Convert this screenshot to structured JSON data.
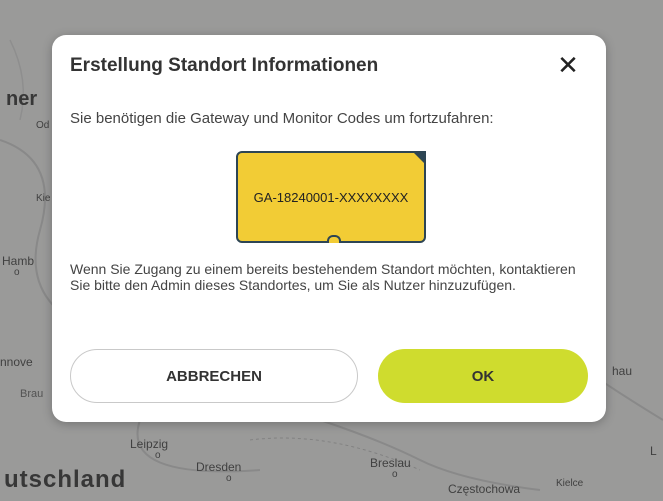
{
  "map": {
    "labels": {
      "ner": "ner",
      "od": "Od",
      "kie": "Kie",
      "hamb": "Hamb",
      "hamb_dot": "o",
      "nnove": "nnove",
      "brau": "Brau",
      "leipzig": "Leipzig",
      "leipzig_dot": "o",
      "dresden": "Dresden",
      "dresden_dot": "o",
      "breslau": "Breslau",
      "breslau_dot": "o",
      "czestochowa": "Częstochowa",
      "czestochowa_dot": "o",
      "kielce": "Kielce",
      "hau": "hau",
      "l": "L",
      "deutschland": "utschland"
    }
  },
  "dialog": {
    "title": "Erstellung Standort Informationen",
    "close_symbol": "✕",
    "intro": "Sie benötigen die Gateway und Monitor Codes um fortzufahren:",
    "card_code": "GA-18240001-XXXXXXXX",
    "info": "Wenn Sie Zugang zu einem bereits bestehendem Standort möchten, kontaktieren Sie bitte den Admin dieses Standortes, um Sie als Nutzer hinzuzufügen.",
    "cancel_label": "ABBRECHEN",
    "ok_label": "OK"
  },
  "colors": {
    "ok_button": "#cfdc2e",
    "card_fill": "#f2cc35",
    "card_border": "#2d4554",
    "overlay": "#5a5a5a"
  }
}
